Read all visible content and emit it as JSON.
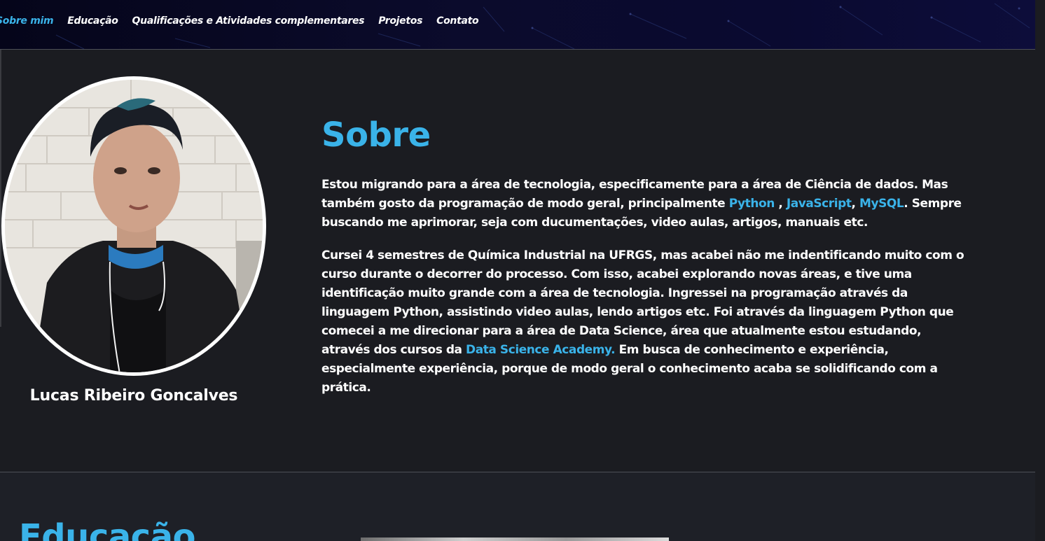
{
  "nav": {
    "items": [
      {
        "label": "Sobre mim",
        "active": true
      },
      {
        "label": "Educação",
        "active": false
      },
      {
        "label": "Qualificações e Atividades complementares",
        "active": false
      },
      {
        "label": "Projetos",
        "active": false
      },
      {
        "label": "Contato",
        "active": false
      }
    ]
  },
  "profile": {
    "name": "Lucas Ribeiro Goncalves"
  },
  "about": {
    "title": "Sobre",
    "p1": {
      "t1": "Estou migrando para a área de tecnologia, especificamente para a área de Ciência de dados. Mas também gosto da programação de modo geral, principalmente ",
      "link1": "Python",
      "t2": " , ",
      "link2": "JavaScript",
      "t3": ", ",
      "link3": "MySQL",
      "t4": ". Sempre buscando me aprimorar, seja com ducumentações, video aulas, artigos, manuais etc."
    },
    "p2": {
      "t1": "Cursei 4 semestres de Química Industrial na UFRGS, mas acabei não me indentificando muito com o curso durante o decorrer do processo. Com isso, acabei explorando novas áreas, e tive uma identificação muito grande com a área de tecnologia. Ingressei na programação através da linguagem Python, assistindo video aulas, lendo artigos etc. Foi através da linguagem Python que comecei a me direcionar para a área de Data Science, área que atualmente estou estudando, através dos cursos da ",
      "link1": "Data Science Academy.",
      "t2": " Em busca de conhecimento e experiência, especialmente experiência, porque de modo geral o conhecimento acaba se solidificando com a prática."
    }
  },
  "education": {
    "title": "Educação"
  },
  "colors": {
    "accent": "#3ab3e9",
    "background": "#1b1c21",
    "navbar": "#0b0b2c",
    "text": "#ffffff"
  }
}
